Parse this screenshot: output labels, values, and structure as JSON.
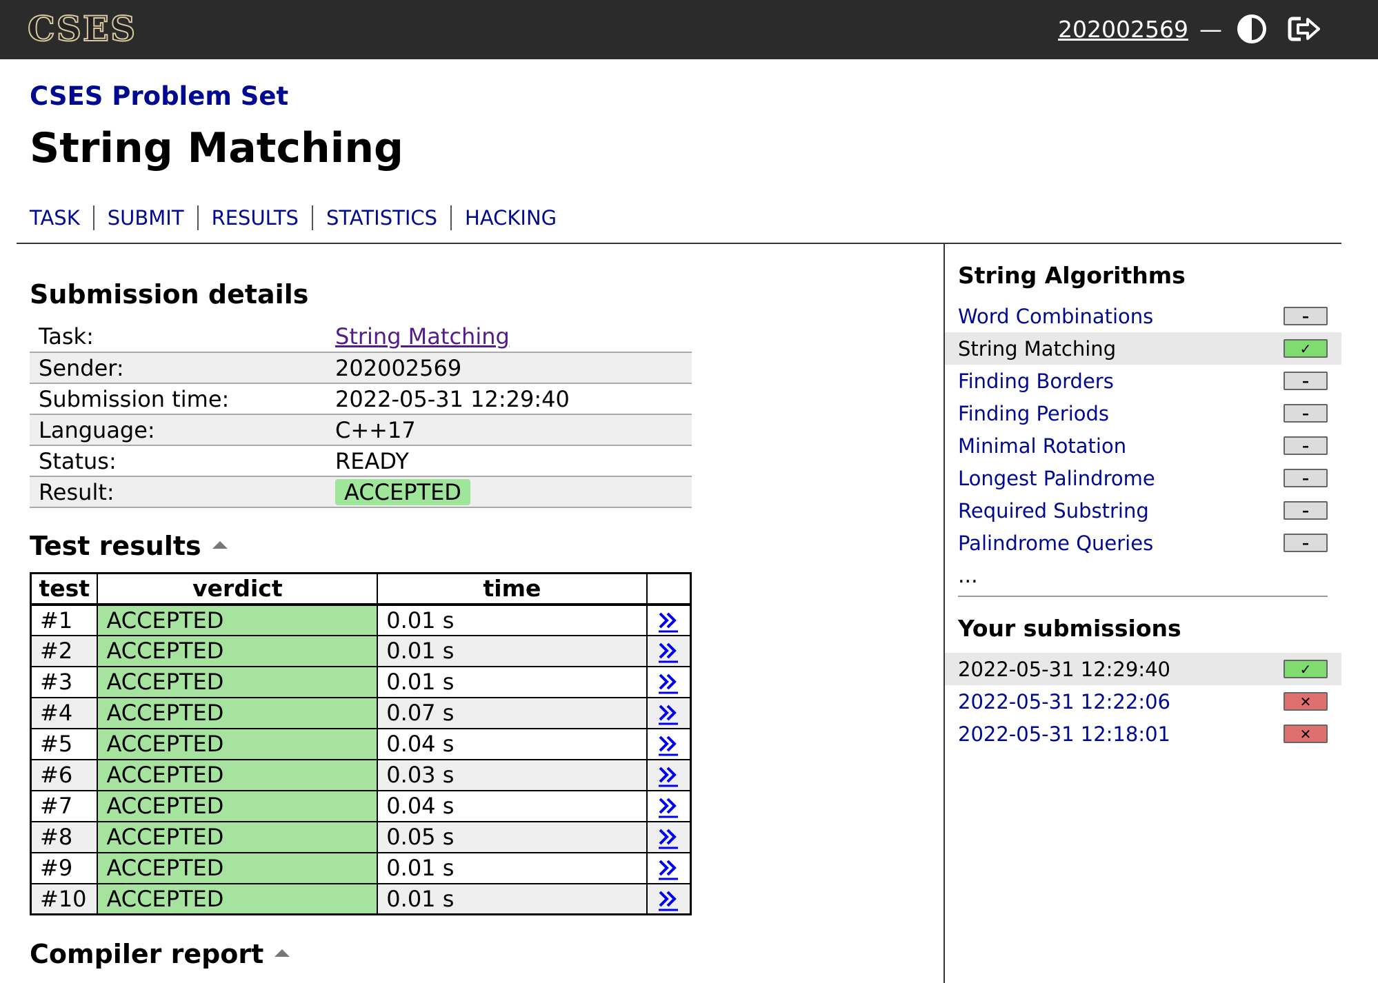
{
  "header": {
    "logo": "CSES",
    "username": "202002569",
    "separator": "—",
    "theme_icon": "contrast-icon",
    "logout_icon": "logout-icon"
  },
  "site_title": "CSES Problem Set",
  "page_title": "String Matching",
  "nav": [
    "TASK",
    "SUBMIT",
    "RESULTS",
    "STATISTICS",
    "HACKING"
  ],
  "details": {
    "heading": "Submission details",
    "rows": [
      {
        "label": "Task:",
        "value": "String Matching"
      },
      {
        "label": "Sender:",
        "value": "202002569"
      },
      {
        "label": "Submission time:",
        "value": "2022-05-31 12:29:40"
      },
      {
        "label": "Language:",
        "value": "C++17"
      },
      {
        "label": "Status:",
        "value": "READY"
      },
      {
        "label": "Result:",
        "value": "ACCEPTED"
      }
    ]
  },
  "tests": {
    "heading": "Test results",
    "columns": [
      "test",
      "verdict",
      "time",
      ""
    ],
    "rows": [
      {
        "test": "#1",
        "verdict": "ACCEPTED",
        "time": "0.01 s"
      },
      {
        "test": "#2",
        "verdict": "ACCEPTED",
        "time": "0.01 s"
      },
      {
        "test": "#3",
        "verdict": "ACCEPTED",
        "time": "0.01 s"
      },
      {
        "test": "#4",
        "verdict": "ACCEPTED",
        "time": "0.07 s"
      },
      {
        "test": "#5",
        "verdict": "ACCEPTED",
        "time": "0.04 s"
      },
      {
        "test": "#6",
        "verdict": "ACCEPTED",
        "time": "0.03 s"
      },
      {
        "test": "#7",
        "verdict": "ACCEPTED",
        "time": "0.04 s"
      },
      {
        "test": "#8",
        "verdict": "ACCEPTED",
        "time": "0.05 s"
      },
      {
        "test": "#9",
        "verdict": "ACCEPTED",
        "time": "0.01 s"
      },
      {
        "test": "#10",
        "verdict": "ACCEPTED",
        "time": "0.01 s"
      }
    ]
  },
  "compiler": {
    "heading": "Compiler report"
  },
  "sidebar": {
    "category_title": "String Algorithms",
    "problems": [
      {
        "label": "Word Combinations",
        "status": "none",
        "status_glyph": "–",
        "current": false
      },
      {
        "label": "String Matching",
        "status": "ok",
        "status_glyph": "✓",
        "current": true
      },
      {
        "label": "Finding Borders",
        "status": "none",
        "status_glyph": "–",
        "current": false
      },
      {
        "label": "Finding Periods",
        "status": "none",
        "status_glyph": "–",
        "current": false
      },
      {
        "label": "Minimal Rotation",
        "status": "none",
        "status_glyph": "–",
        "current": false
      },
      {
        "label": "Longest Palindrome",
        "status": "none",
        "status_glyph": "–",
        "current": false
      },
      {
        "label": "Required Substring",
        "status": "none",
        "status_glyph": "–",
        "current": false
      },
      {
        "label": "Palindrome Queries",
        "status": "none",
        "status_glyph": "–",
        "current": false
      }
    ],
    "more": "...",
    "submissions_title": "Your submissions",
    "submissions": [
      {
        "label": "2022-05-31 12:29:40",
        "status": "ok",
        "status_glyph": "✓",
        "current": true
      },
      {
        "label": "2022-05-31 12:22:06",
        "status": "fail",
        "status_glyph": "✕",
        "current": false
      },
      {
        "label": "2022-05-31 12:18:01",
        "status": "fail",
        "status_glyph": "✕",
        "current": false
      }
    ]
  },
  "colors": {
    "link": "#000a90",
    "accepted": "#9fe59a",
    "status_ok": "#7fdc6f",
    "status_fail": "#e07070",
    "topbar": "#2b2b2b"
  }
}
